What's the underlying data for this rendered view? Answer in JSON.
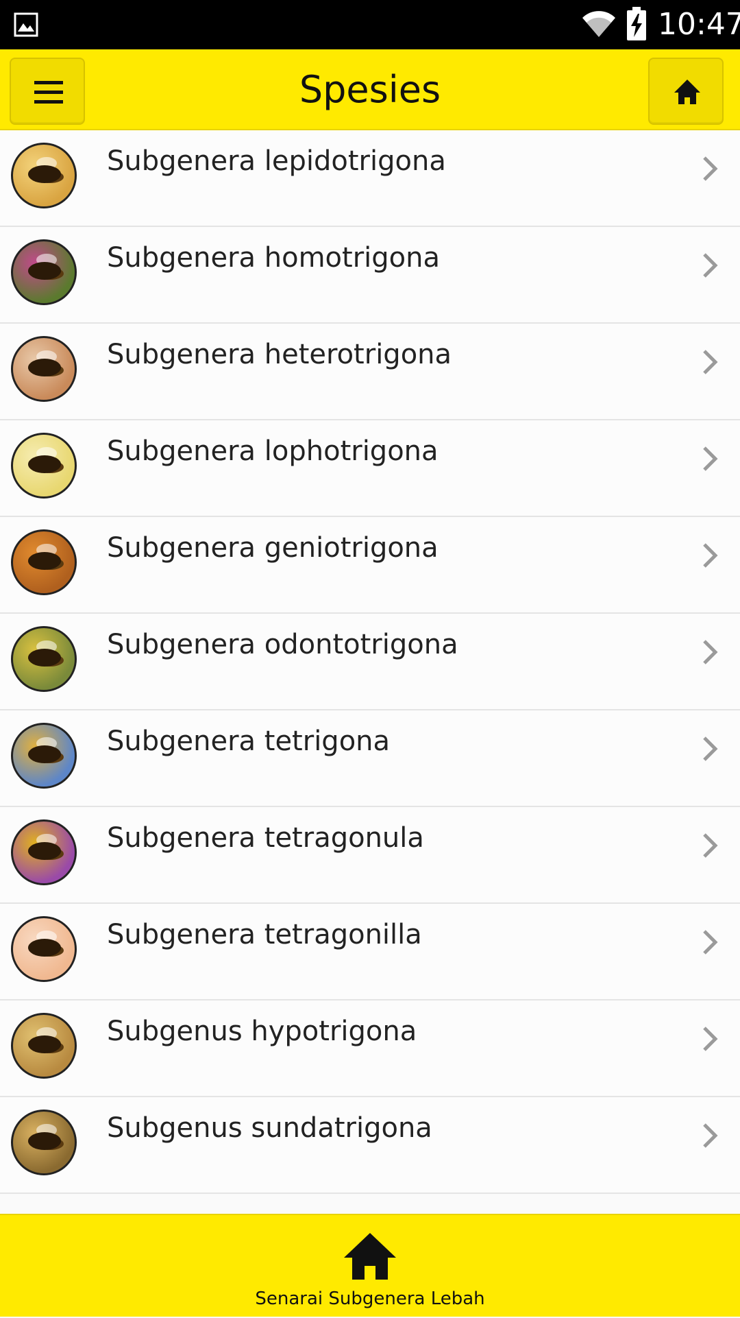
{
  "status_bar": {
    "time": "10:47",
    "icons": [
      "gallery-icon",
      "wifi-icon",
      "battery-charging-icon"
    ]
  },
  "header": {
    "title": "Spesies",
    "left_button_icon": "hamburger-menu-icon",
    "right_button_icon": "home-icon"
  },
  "species": [
    {
      "label": "Subgenera lepidotrigona",
      "thumb_bg": "#d9a441",
      "thumb_accent": "#f3d27a"
    },
    {
      "label": "Subgenera homotrigona",
      "thumb_bg": "#5b7a2e",
      "thumb_accent": "#c04a8a"
    },
    {
      "label": "Subgenera heterotrigona",
      "thumb_bg": "#c98a5a",
      "thumb_accent": "#e8c8a8"
    },
    {
      "label": "Subgenera lophotrigona",
      "thumb_bg": "#e8d770",
      "thumb_accent": "#f6ecb0"
    },
    {
      "label": "Subgenera geniotrigona",
      "thumb_bg": "#b0601e",
      "thumb_accent": "#e08a2e"
    },
    {
      "label": "Subgenera odontotrigona",
      "thumb_bg": "#7a8a3a",
      "thumb_accent": "#d8c040"
    },
    {
      "label": "Subgenera tetrigona",
      "thumb_bg": "#5d86c8",
      "thumb_accent": "#e0b040"
    },
    {
      "label": "Subgenera tetragonula",
      "thumb_bg": "#9a4aa8",
      "thumb_accent": "#e0b020"
    },
    {
      "label": "Subgenera tetragonilla",
      "thumb_bg": "#f0b890",
      "thumb_accent": "#f8d8c0"
    },
    {
      "label": "Subgenus hypotrigona",
      "thumb_bg": "#b88a40",
      "thumb_accent": "#e0c070"
    },
    {
      "label": "Subgenus sundatrigona",
      "thumb_bg": "#8a6a30",
      "thumb_accent": "#d8b060"
    }
  ],
  "bottom_tab": {
    "label": "Senarai Subgenera Lebah",
    "icon": "home-icon"
  },
  "colors": {
    "accent": "#ffea00",
    "text": "#222222",
    "chevron": "#9a9a9a"
  }
}
